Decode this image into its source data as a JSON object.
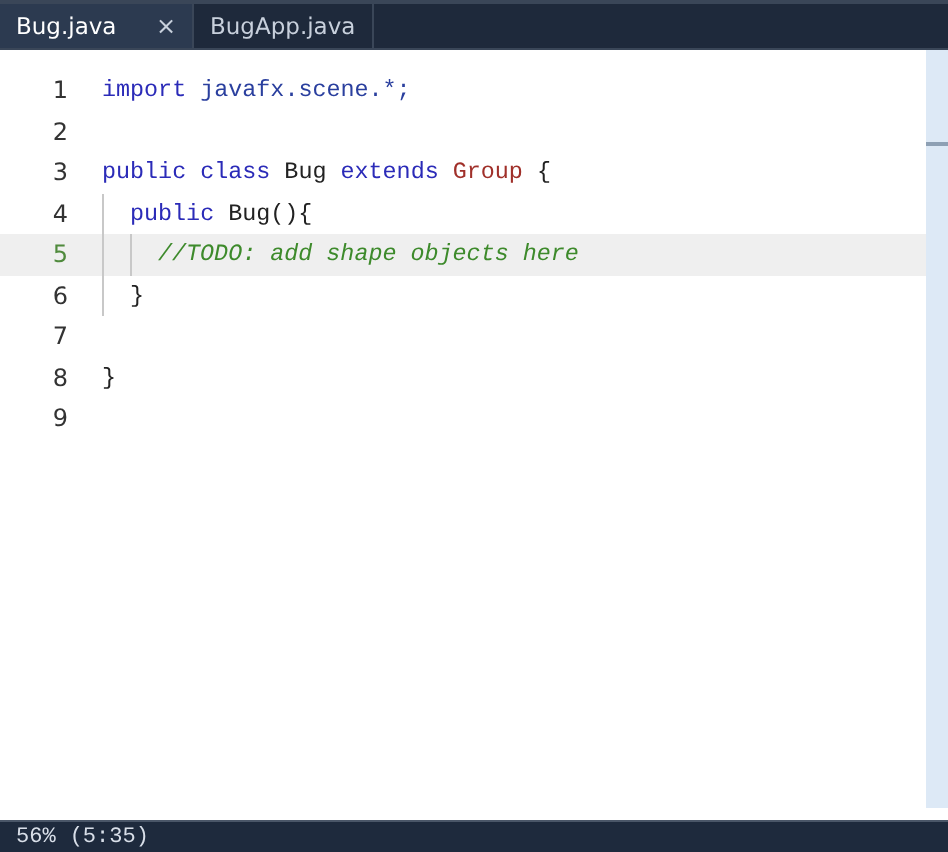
{
  "tabs": [
    {
      "label": "Bug.java",
      "selected": true,
      "close": "×"
    },
    {
      "label": "BugApp.java",
      "selected": false
    }
  ],
  "editor": {
    "lines": [
      {
        "number": "1",
        "current": false,
        "tokens": [
          {
            "kind": "keyword",
            "text": "import"
          },
          {
            "kind": "package",
            "text": " javafx.scene.*;"
          }
        ]
      },
      {
        "number": "2",
        "current": false
      },
      {
        "number": "3",
        "current": false,
        "tokens": [
          {
            "kind": "keyword",
            "text": "public class"
          },
          {
            "kind": "plain",
            "text": " Bug "
          },
          {
            "kind": "keyword",
            "text": "extends"
          },
          {
            "kind": "type",
            "text": " Group"
          },
          {
            "kind": "plain",
            "text": " {"
          }
        ]
      },
      {
        "number": "4",
        "current": false,
        "tokens": [
          {
            "kind": "keyword",
            "text": "  public"
          },
          {
            "kind": "plain",
            "text": " Bug(){"
          }
        ]
      },
      {
        "number": "5",
        "current": true,
        "tokens": [
          {
            "kind": "comment",
            "text": "    //TODO: add shape objects here"
          }
        ]
      },
      {
        "number": "6",
        "current": false,
        "tokens": [
          {
            "kind": "plain",
            "text": "  }"
          }
        ]
      },
      {
        "number": "7",
        "current": false
      },
      {
        "number": "8",
        "current": false,
        "tokens": [
          {
            "kind": "plain",
            "text": "}"
          }
        ]
      },
      {
        "number": "9",
        "current": false
      }
    ]
  },
  "status_bar": {
    "zoom": "56%",
    "position": "(5:35)"
  }
}
